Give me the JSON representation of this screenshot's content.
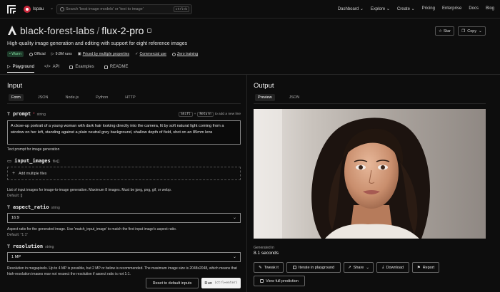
{
  "nav": {
    "username": "lspau",
    "search_placeholder": "Search 'best image models' or 'text to image'",
    "search_shortcut": "ctrl+k",
    "links": [
      "Dashboard ⌄",
      "Explore ⌄",
      "Create ⌄",
      "Pricing",
      "Enterprise",
      "Docs",
      "Blog"
    ]
  },
  "header": {
    "org": "black-forest-labs",
    "model": "flux-2-pro",
    "subtitle": "High-quality image generation and editing with support for eight reference images",
    "star_label": "Star",
    "copy_label": "Copy",
    "badges": {
      "warm": "• Warm",
      "official": "Official",
      "runs": "9.8M runs",
      "priced": "Priced by multiple properties",
      "commercial": "Commercial use",
      "training": "Zero training"
    },
    "tabs": [
      "Playground",
      "API",
      "Examples",
      "README"
    ]
  },
  "input": {
    "title": "Input",
    "tabs": [
      "Form",
      "JSON",
      "Node.js",
      "Python",
      "HTTP"
    ],
    "prompt": {
      "name": "prompt",
      "required": "*",
      "type": "string",
      "hint_key1": "Shift",
      "hint_plus": "+",
      "hint_key2": "Return",
      "hint_text": "to add a new line",
      "value": "A close-up portrait of a young woman with dark hair looking directly into the camera, lit by soft natural light coming from a window on her left, standing against a plain neutral grey background, shallow depth of field, shot on an 85mm lens",
      "help": "Text prompt for image generation"
    },
    "input_images": {
      "name": "input_images",
      "type": "file[]",
      "dropzone": "Add multiple files",
      "help": "List of input images for image-to-image generation. Maximum 8 images. Must be jpeg, png, gif, or webp.",
      "default": "Default: []"
    },
    "aspect_ratio": {
      "name": "aspect_ratio",
      "type": "string",
      "value": "16:9",
      "help": "Aspect ratio for the generated image. Use 'match_input_image' to match the first input image's aspect ratio.",
      "default": "Default: \"1:1\""
    },
    "resolution": {
      "name": "resolution",
      "type": "string",
      "value": "1 MP",
      "help": "Resolution in megapixels. Up to 4 MP is possible, but 2 MP or below is recommended. The maximum image size is 2048x2048, which means that high-resolution images may not respect the resolution if aspect ratio is not 1:1."
    },
    "reset_label": "Reset to default inputs",
    "run_label": "Run",
    "run_shortcut": "(ctrl+enter)"
  },
  "output": {
    "title": "Output",
    "tabs": [
      "Preview",
      "JSON"
    ],
    "generated_label": "Generated in",
    "generated_value": "8.1 seconds",
    "buttons": {
      "tweak": "Tweak it",
      "iterate": "Iterate in playground",
      "share": "Share",
      "download": "Download",
      "report": "Report",
      "full": "View full prediction"
    }
  }
}
